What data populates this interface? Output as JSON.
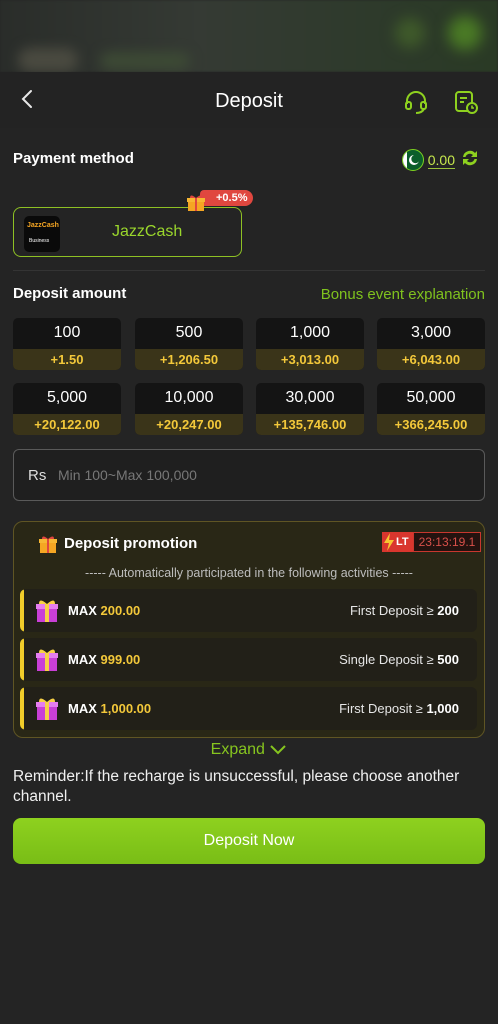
{
  "header": {
    "title": "Deposit",
    "icons": [
      "back-chevron-icon",
      "headset-icon",
      "history-icon"
    ]
  },
  "payment": {
    "label": "Payment method",
    "balance": "0.00",
    "method": {
      "name": "JazzCash",
      "logo_text": "JazzCash",
      "logo_sub": "Business",
      "bonus_badge": "+0.5%"
    }
  },
  "deposit": {
    "label": "Deposit amount",
    "bonus_link": "Bonus event explanation",
    "amounts": [
      {
        "value": "100",
        "bonus": "+1.50"
      },
      {
        "value": "500",
        "bonus": "+1,206.50"
      },
      {
        "value": "1,000",
        "bonus": "+3,013.00"
      },
      {
        "value": "3,000",
        "bonus": "+6,043.00"
      },
      {
        "value": "5,000",
        "bonus": "+20,122.00"
      },
      {
        "value": "10,000",
        "bonus": "+20,247.00"
      },
      {
        "value": "30,000",
        "bonus": "+135,746.00"
      },
      {
        "value": "50,000",
        "bonus": "+366,245.00"
      }
    ],
    "currency": "Rs",
    "placeholder": "Min 100~Max 100,000"
  },
  "promotion": {
    "title": "Deposit promotion",
    "lt_tag": "LT",
    "timer": "23:13:19.1",
    "subtitle": "----- Automatically participated in the following activities -----",
    "items": [
      {
        "max_label": "MAX",
        "max_value": "200.00",
        "condition": "First Deposit ≥",
        "threshold": "200"
      },
      {
        "max_label": "MAX",
        "max_value": "999.00",
        "condition": "Single Deposit ≥",
        "threshold": "500"
      },
      {
        "max_label": "MAX",
        "max_value": "1,000.00",
        "condition": "First Deposit ≥",
        "threshold": "1,000"
      }
    ],
    "expand_label": "Expand"
  },
  "reminder": "Reminder:If the recharge is unsuccessful, please choose another channel.",
  "submit_label": "Deposit Now",
  "colors": {
    "accent": "#86c51f",
    "gold": "#f3c83a",
    "danger": "#d9362e",
    "background": "#242424"
  }
}
